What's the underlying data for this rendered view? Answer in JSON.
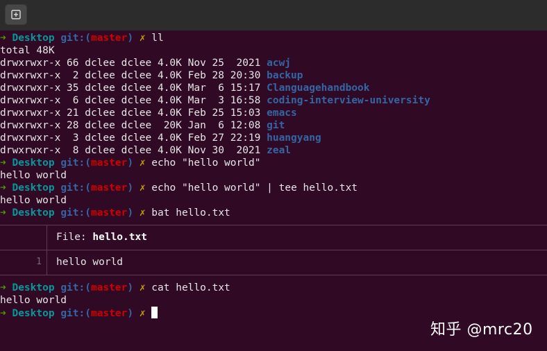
{
  "prompt": {
    "arrow": "➜",
    "cwd": "Desktop",
    "git_prefix": "git:(",
    "branch": "master",
    "git_suffix": ")",
    "dirty_mark": "✗"
  },
  "ll": {
    "command": "ll",
    "total": "total 48K",
    "entries": [
      {
        "meta": "drwxrwxr-x 66 dclee dclee 4.0K Nov 25  2021 ",
        "name": "acwj"
      },
      {
        "meta": "drwxrwxr-x  2 dclee dclee 4.0K Feb 28 20:30 ",
        "name": "backup"
      },
      {
        "meta": "drwxrwxr-x 35 dclee dclee 4.0K Mar  6 15:17 ",
        "name": "Clanguagehandbook"
      },
      {
        "meta": "drwxrwxr-x  6 dclee dclee 4.0K Mar  3 16:58 ",
        "name": "coding-interview-university"
      },
      {
        "meta": "drwxrwxr-x 21 dclee dclee 4.0K Feb 25 15:03 ",
        "name": "emacs"
      },
      {
        "meta": "drwxrwxr-x 28 dclee dclee  20K Jan  6 12:08 ",
        "name": "git"
      },
      {
        "meta": "drwxrwxr-x  3 dclee dclee 4.0K Feb 27 22:19 ",
        "name": "huangyang"
      },
      {
        "meta": "drwxrwxr-x  8 dclee dclee 4.0K Nov 30  2021 ",
        "name": "zeal"
      }
    ]
  },
  "echo1": {
    "command": "echo \"hello world\"",
    "output": "hello world"
  },
  "echo2": {
    "command": "echo \"hello world\" | tee hello.txt",
    "output": "hello world"
  },
  "bat": {
    "command": "bat hello.txt",
    "file_label": "File: ",
    "file_name": "hello.txt",
    "line_number": "1",
    "line_content": "hello world"
  },
  "cat": {
    "command": "cat hello.txt",
    "output": "hello world"
  },
  "watermark": "知乎 @mrc20",
  "colors": {
    "background": "#300a24",
    "arrow": "#4e9a06",
    "cwd": "#06989a",
    "git": "#3465a4",
    "branch": "#cc0000",
    "dirty": "#c4a000",
    "directory": "#3465a4"
  }
}
